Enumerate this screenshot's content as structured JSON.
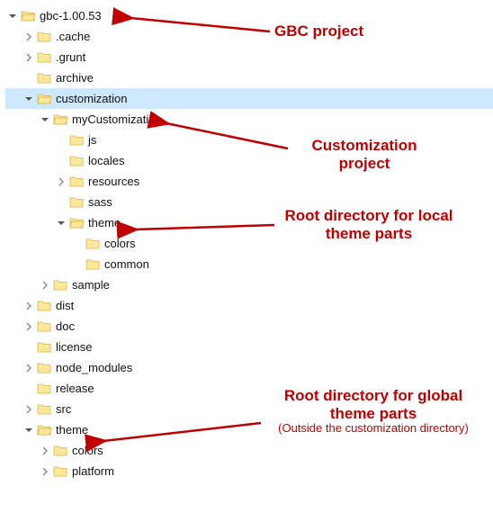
{
  "colors": {
    "annotation": "#c00000",
    "folder_fill": "#ffe89a",
    "folder_stroke": "#d8b24a",
    "selection": "#cde8ff"
  },
  "tree": {
    "rows": [
      {
        "indent": 0,
        "chev": "down",
        "open": true,
        "label": "gbc-1.00.53"
      },
      {
        "indent": 1,
        "chev": "right",
        "open": false,
        "label": ".cache"
      },
      {
        "indent": 1,
        "chev": "right",
        "open": false,
        "label": ".grunt"
      },
      {
        "indent": 1,
        "chev": "none",
        "open": false,
        "label": "archive"
      },
      {
        "indent": 1,
        "chev": "down",
        "open": true,
        "label": "customization",
        "selected": true
      },
      {
        "indent": 2,
        "chev": "down",
        "open": true,
        "label": "myCustomization"
      },
      {
        "indent": 3,
        "chev": "none",
        "open": false,
        "label": "js"
      },
      {
        "indent": 3,
        "chev": "none",
        "open": false,
        "label": "locales"
      },
      {
        "indent": 3,
        "chev": "right",
        "open": false,
        "label": "resources"
      },
      {
        "indent": 3,
        "chev": "none",
        "open": false,
        "label": "sass"
      },
      {
        "indent": 3,
        "chev": "down",
        "open": true,
        "label": "theme"
      },
      {
        "indent": 4,
        "chev": "none",
        "open": false,
        "label": "colors"
      },
      {
        "indent": 4,
        "chev": "none",
        "open": false,
        "label": "common"
      },
      {
        "indent": 2,
        "chev": "right",
        "open": false,
        "label": "sample"
      },
      {
        "indent": 1,
        "chev": "right",
        "open": false,
        "label": "dist"
      },
      {
        "indent": 1,
        "chev": "right",
        "open": false,
        "label": "doc"
      },
      {
        "indent": 1,
        "chev": "none",
        "open": false,
        "label": "license"
      },
      {
        "indent": 1,
        "chev": "right",
        "open": false,
        "label": "node_modules"
      },
      {
        "indent": 1,
        "chev": "none",
        "open": false,
        "label": "release"
      },
      {
        "indent": 1,
        "chev": "right",
        "open": false,
        "label": "src"
      },
      {
        "indent": 1,
        "chev": "down",
        "open": true,
        "label": "theme"
      },
      {
        "indent": 2,
        "chev": "right",
        "open": false,
        "label": "colors"
      },
      {
        "indent": 2,
        "chev": "right",
        "open": false,
        "label": "platform"
      }
    ]
  },
  "annotations": {
    "a1": "GBC project",
    "a2": "Customization project",
    "a3": "Root directory for local theme parts",
    "a4": "Root directory for global theme parts",
    "a4_sub": "(Outside the customization directory)"
  }
}
